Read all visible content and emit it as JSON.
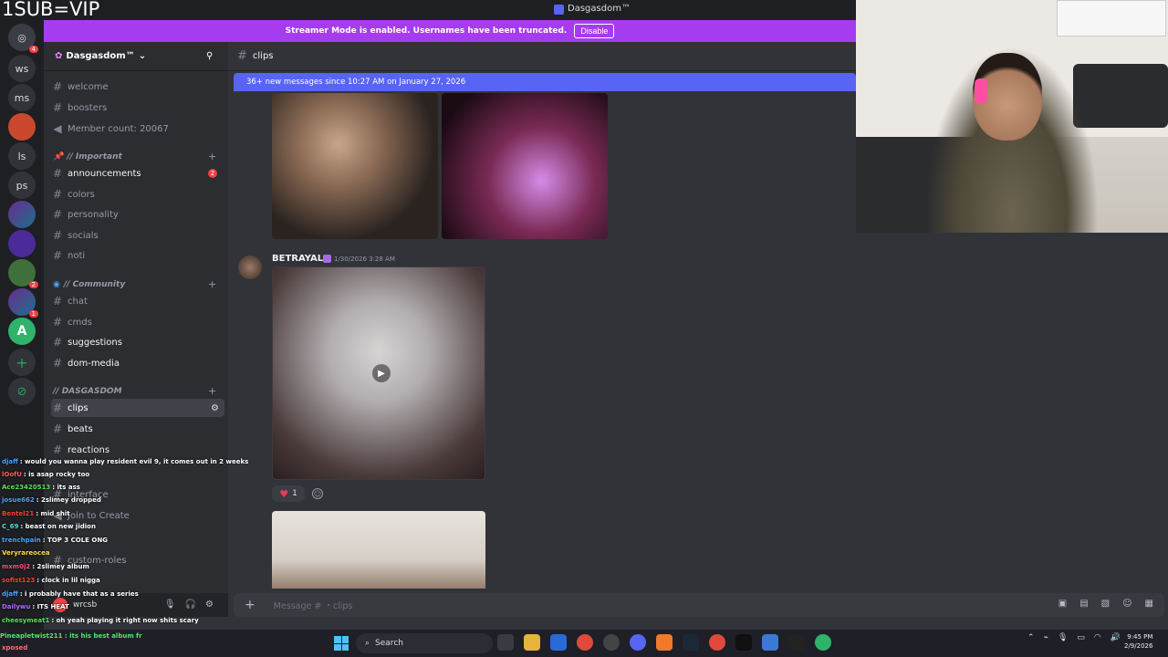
{
  "overlay": {
    "text": "1SUB=VIP"
  },
  "window": {
    "title": "Dasgasdom™"
  },
  "streamer_banner": {
    "text": "Streamer Mode is enabled. Usernames have been truncated.",
    "disable_label": "Disable"
  },
  "server_rail": {
    "items": [
      "ws",
      "ms",
      "ls",
      "ps"
    ],
    "badge": "4",
    "badge2": "2",
    "badge3": "1"
  },
  "sidebar": {
    "server_name": "Dasgasdom™",
    "channels_top": [
      "welcome",
      "boosters"
    ],
    "member_count": "Member count: 20067",
    "cat_important": "// Important",
    "important_channels": [
      "announcements",
      "colors",
      "personality",
      "socials",
      "noti"
    ],
    "announcements_badge": "2",
    "cat_community": "// Community",
    "community_channels": [
      "chat",
      "cmds",
      "suggestions",
      "dom-media"
    ],
    "cat_dasgasdom": "// DASGASDOM",
    "dasgasdom_channels": [
      "clips",
      "beats",
      "reactions"
    ],
    "lower_channels": [
      "interface",
      "Join to Create",
      "custom-roles"
    ]
  },
  "chat_header": {
    "channel": "clips"
  },
  "new_messages": {
    "text": "36+ new messages since 10:27 AM on January 27, 2026"
  },
  "message": {
    "author": "BETRAYAL",
    "timestamp": "1/30/2026 3:28 AM",
    "reaction_count": "1"
  },
  "composer": {
    "placeholder": "Message # ・clips"
  },
  "user_panel": {
    "name": "wrcsb"
  },
  "chat_overlay": [
    {
      "name": "djaff",
      "text": ": would you wanna play resident evil 9, it comes out in 2 weeks",
      "color": "#4aa3ff"
    },
    {
      "name": "lOofU",
      "text": ": is asap rocky too",
      "color": "#ff5a5a"
    },
    {
      "name": "Ace23420513",
      "text": ": its ass",
      "color": "#58e05a"
    },
    {
      "name": "josue662",
      "text": ": 2slimey dropped",
      "color": "#4aa3ff"
    },
    {
      "name": "Bentel21",
      "text": ": mid shit",
      "color": "#ff3b3b"
    },
    {
      "name": "C_69",
      "text": ": beast on new jidion",
      "color": "#4adfd0"
    },
    {
      "name": "trenchpain",
      "text": ": TOP 3 COLE ONG",
      "color": "#4aa3ff"
    },
    {
      "name": "Veryrareocea",
      "text": "",
      "color": "#ffd84a"
    },
    {
      "name": "mxm0j2",
      "text": ": 2slimey album",
      "color": "#ff4d7a"
    },
    {
      "name": "sofist123",
      "text": ": clock in lil nigga",
      "color": "#ff3b3b"
    },
    {
      "name": "djaff",
      "text": ": i probably have that as a series",
      "color": "#4aa3ff"
    },
    {
      "name": "Dailywu",
      "text": ": ITS HEAT",
      "color": "#b06bff"
    },
    {
      "name": "cheesymeat1",
      "text": ": oh yeah playing it right now shits scary",
      "color": "#58e05a"
    }
  ],
  "taskbar": {
    "search_placeholder": "Search",
    "time": "9:45 PM",
    "date": "2/9/2026"
  },
  "tray_notice": "Pineapletwist211 : its his best album fr",
  "xposed": "xposed",
  "colors": {
    "blurple": "#5865f2",
    "streamer": "#a63cf0",
    "bg": "#313338"
  }
}
